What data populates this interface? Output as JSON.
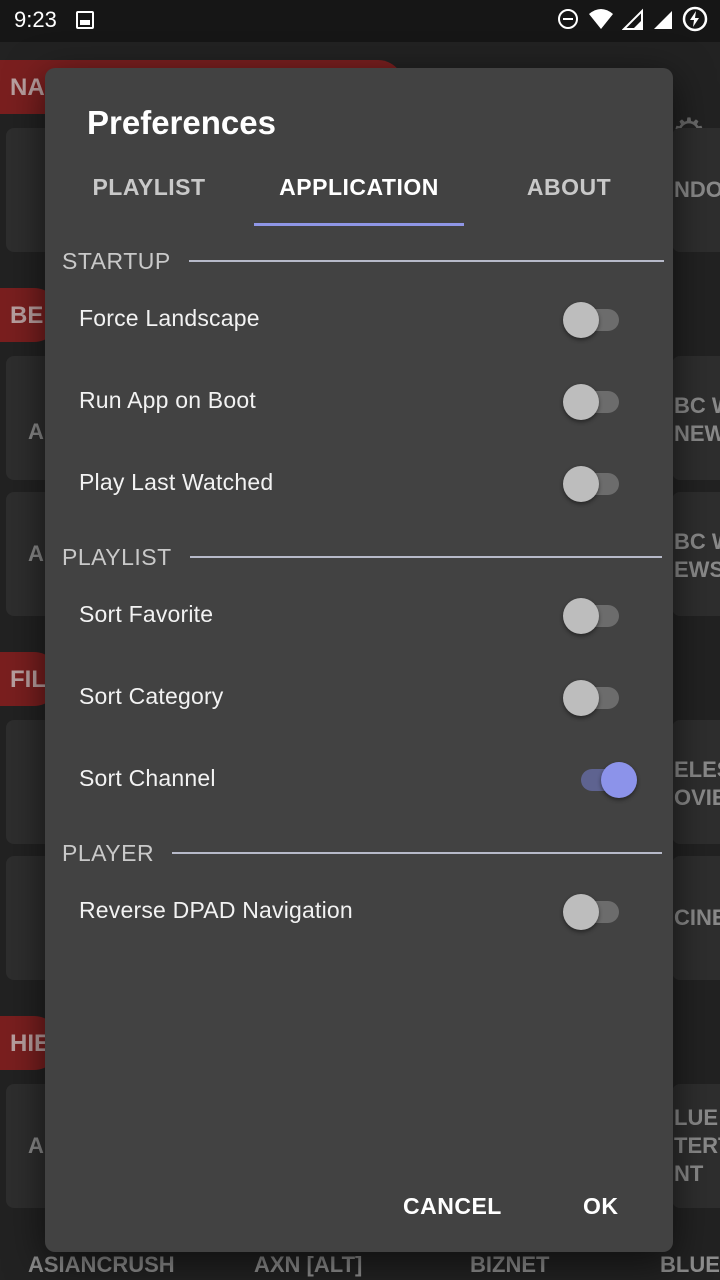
{
  "status_bar": {
    "time": "9:23",
    "icons": [
      "image-icon",
      "do-not-disturb-icon",
      "wifi-icon",
      "signal-icon",
      "signal-icon",
      "battery-charging-icon"
    ]
  },
  "background": {
    "badges": [
      "NA",
      "BEI",
      "FIL",
      "HIE"
    ],
    "right_tiles": [
      "NDOS",
      "BC W\nNEW",
      "BC W\nEWS",
      "ELES\nOVIE",
      "CINE",
      "LUE\nTERT\nNT"
    ],
    "left_tiles": [
      "A",
      "A",
      "A"
    ],
    "bottom_labels": [
      "ASIANCRUSH",
      "AXN [ALT]",
      "BIZNET",
      "BLUE"
    ]
  },
  "dialog": {
    "title": "Preferences",
    "tabs": [
      {
        "label": "PLAYLIST",
        "active": false
      },
      {
        "label": "APPLICATION",
        "active": true
      },
      {
        "label": "ABOUT",
        "active": false
      }
    ],
    "sections": {
      "startup": "STARTUP",
      "playlist": "PLAYLIST",
      "player": "PLAYER"
    },
    "prefs": {
      "force_landscape": {
        "label": "Force Landscape",
        "on": false
      },
      "run_on_boot": {
        "label": "Run App on Boot",
        "on": false
      },
      "play_last": {
        "label": "Play Last Watched",
        "on": false
      },
      "sort_favorite": {
        "label": "Sort Favorite",
        "on": false
      },
      "sort_category": {
        "label": "Sort Category",
        "on": false
      },
      "sort_channel": {
        "label": "Sort Channel",
        "on": true
      },
      "reverse_dpad": {
        "label": "Reverse DPAD Navigation",
        "on": false
      }
    },
    "cancel_label": "CANCEL",
    "ok_label": "OK"
  },
  "colors": {
    "accent": "#8c93ea",
    "dialog_bg": "#424242",
    "switch_off_thumb": "#bdbdbd"
  }
}
